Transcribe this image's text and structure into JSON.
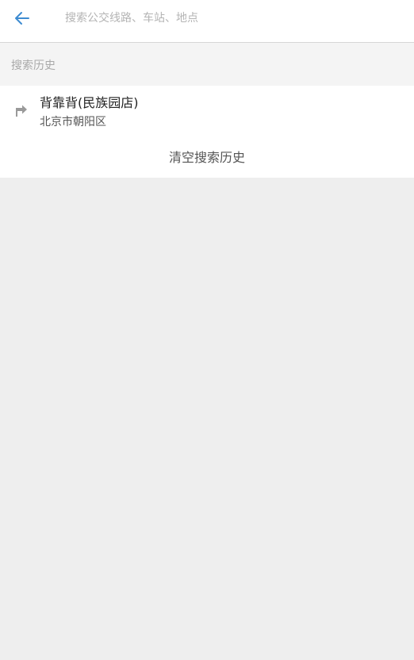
{
  "header": {
    "back_icon": "arrow-left-icon",
    "search_placeholder": "搜索公交线路、车站、地点",
    "accent_color": "#3d8bd1"
  },
  "history": {
    "title": "搜索历史",
    "items": [
      {
        "icon": "turn-arrow-icon",
        "name": "背靠背(民族园店)",
        "area": "北京市朝阳区"
      }
    ],
    "clear_label": "清空搜索历史"
  }
}
